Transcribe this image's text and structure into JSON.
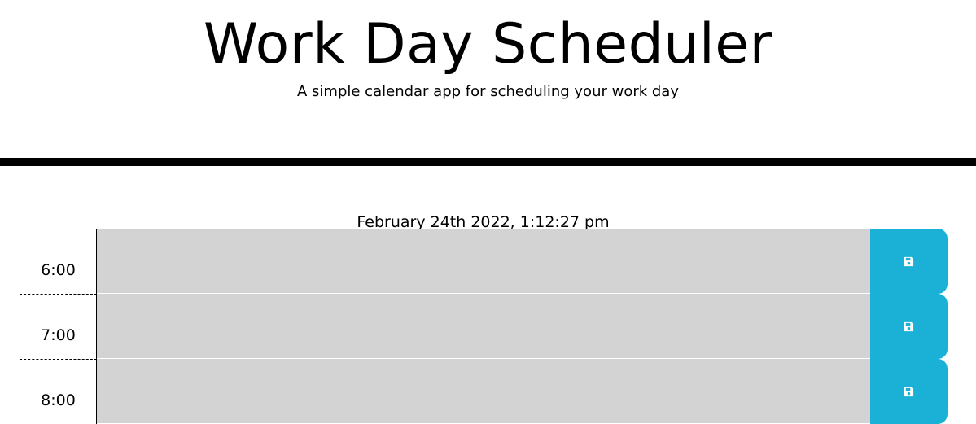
{
  "header": {
    "title": "Work Day Scheduler",
    "subtitle": "A simple calendar app for scheduling your work day"
  },
  "current_day": "February 24th 2022, 1:12:27 pm",
  "colors": {
    "past": "#d3d3d3",
    "save_button": "#1bb0d6",
    "divider": "#000000"
  },
  "time_blocks": [
    {
      "hour": "6:00",
      "description": "",
      "save_icon": "floppy-disk-icon"
    },
    {
      "hour": "7:00",
      "description": "",
      "save_icon": "floppy-disk-icon"
    },
    {
      "hour": "8:00",
      "description": "",
      "save_icon": "floppy-disk-icon"
    }
  ]
}
